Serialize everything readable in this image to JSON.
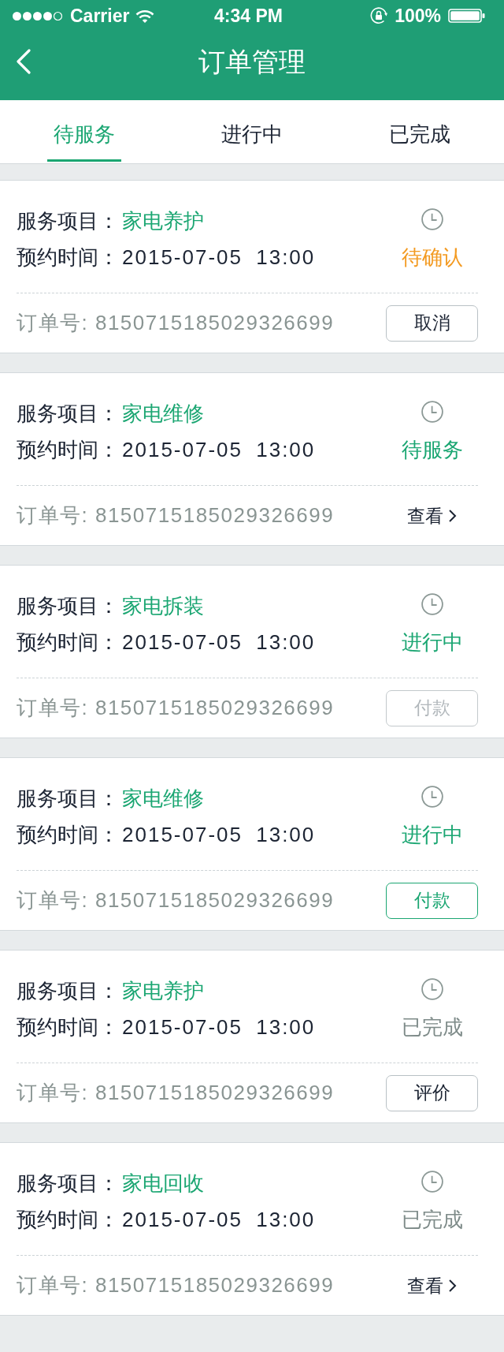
{
  "status_bar": {
    "carrier": "Carrier",
    "time": "4:34 PM",
    "battery": "100%"
  },
  "nav": {
    "title": "订单管理"
  },
  "tabs": [
    {
      "label": "待服务",
      "selected": true
    },
    {
      "label": "进行中",
      "selected": false
    },
    {
      "label": "已完成",
      "selected": false
    }
  ],
  "orders": [
    {
      "service_label": "服务项目：",
      "service": "家电养护",
      "time_label": "预约时间：",
      "time": "2015-07-05 13:00",
      "status": {
        "text": "待确认",
        "color": "#f39a21"
      },
      "order_no": "订单号: 8150715185029326699",
      "action": {
        "kind": "button",
        "label": "取消",
        "disabled": false,
        "primary": false
      }
    },
    {
      "service_label": "服务项目：",
      "service": "家电维修",
      "time_label": "预约时间：",
      "time": "2015-07-05 13:00",
      "status": {
        "text": "待服务",
        "color": "#1ba672"
      },
      "order_no": "订单号: 8150715185029326699",
      "action": {
        "kind": "link",
        "label": "查看"
      }
    },
    {
      "service_label": "服务项目：",
      "service": "家电拆装",
      "time_label": "预约时间：",
      "time": "2015-07-05 13:00",
      "status": {
        "text": "进行中",
        "color": "#1ba672"
      },
      "order_no": "订单号: 8150715185029326699",
      "action": {
        "kind": "button",
        "label": "付款",
        "disabled": true,
        "primary": false
      }
    },
    {
      "service_label": "服务项目：",
      "service": "家电维修",
      "time_label": "预约时间：",
      "time": "2015-07-05 13:00",
      "status": {
        "text": "进行中",
        "color": "#1ba672"
      },
      "order_no": "订单号: 8150715185029326699",
      "action": {
        "kind": "button",
        "label": "付款",
        "disabled": false,
        "primary": true
      }
    },
    {
      "service_label": "服务项目：",
      "service": "家电养护",
      "time_label": "预约时间：",
      "time": "2015-07-05 13:00",
      "status": {
        "text": "已完成",
        "color": "#7e8b89"
      },
      "order_no": "订单号: 8150715185029326699",
      "action": {
        "kind": "button",
        "label": "评价",
        "disabled": false,
        "primary": false
      }
    },
    {
      "service_label": "服务项目：",
      "service": "家电回收",
      "time_label": "预约时间：",
      "time": "2015-07-05 13:00",
      "status": {
        "text": "已完成",
        "color": "#7e8b89"
      },
      "order_no": "订单号: 8150715185029326699",
      "action": {
        "kind": "link",
        "label": "查看"
      }
    }
  ]
}
